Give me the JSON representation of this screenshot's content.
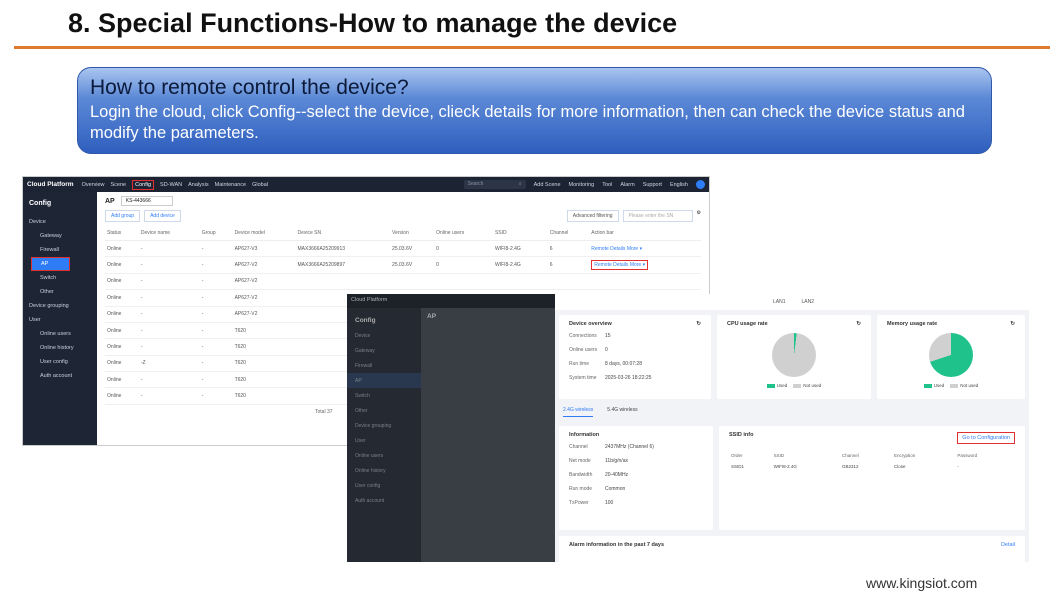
{
  "slide": {
    "title": "8. Special Functions-How to manage the device",
    "banner_title": "How to remote control the device?",
    "banner_text": "Login the cloud, click Config--select the device, clieck details for more information, then can check the device status and modify the parameters.",
    "footer": "www.kingsiot.com",
    "colors": {
      "rule": "#e07a2e",
      "banner": "#2f5fbf",
      "highlight": "#e03030"
    }
  },
  "ss1": {
    "brand": "Cloud Platform",
    "nav": [
      "Overview",
      "Scene",
      "Config",
      "SD-WAN",
      "Analysis",
      "Maintenance",
      "Global"
    ],
    "search_placeholder": "Search",
    "right_items": [
      "Add Scene",
      "Monitoring",
      "Tool",
      "Alarm",
      "Support",
      "English"
    ],
    "sidebar": {
      "header": "Config",
      "device": "Device",
      "device_subs": [
        "Gateway",
        "Firewall",
        "AP",
        "Switch",
        "Other"
      ],
      "device_grouping": "Device grouping",
      "user": "User",
      "user_subs": [
        "Online users",
        "Online history",
        "User config",
        "Auth account"
      ]
    },
    "ap_label": "AP",
    "select_value": "KS-443666",
    "buttons": {
      "add_group": "Add group",
      "add_device": "Add device",
      "advanced_filtering": "Advanced filtering",
      "sn_placeholder": "Please enter the SN"
    },
    "columns": [
      "Status",
      "Device name",
      "Group",
      "Device model",
      "Device SN",
      "Version",
      "Online users",
      "SSID",
      "Channel",
      "Action bar"
    ],
    "rows": [
      [
        "Online",
        "-",
        "-",
        "AP627-V3",
        "MAX3666A25209913",
        "25.03.6V",
        "0",
        "WIFI8-2.4G",
        "6",
        "Remote  Details  More ▾"
      ],
      [
        "Online",
        "-",
        "-",
        "AP627-V2",
        "MAX3666A25209897",
        "25.03.6V",
        "0",
        "WIFI8-2.4G",
        "6",
        "Remote  Details  More ▾"
      ],
      [
        "Online",
        "-",
        "-",
        "AP627-V2",
        "",
        "",
        "",
        "",
        "",
        ""
      ],
      [
        "Online",
        "-",
        "-",
        "AP627-V2",
        "",
        "",
        "",
        "",
        "",
        ""
      ],
      [
        "Online",
        "-",
        "-",
        "AP627-V2",
        "",
        "",
        "",
        "",
        "",
        ""
      ],
      [
        "Online",
        "-",
        "-",
        "T620",
        "",
        "",
        "",
        "",
        "",
        ""
      ],
      [
        "Online",
        "-",
        "-",
        "T620",
        "",
        "",
        "",
        "",
        "",
        ""
      ],
      [
        "Online",
        "-Z",
        "-",
        "T620",
        "",
        "",
        "",
        "",
        "",
        ""
      ],
      [
        "Online",
        "-",
        "-",
        "T620",
        "",
        "",
        "",
        "",
        "",
        ""
      ],
      [
        "Online",
        "-",
        "-",
        "T620",
        "",
        "",
        "",
        "",
        "",
        ""
      ]
    ],
    "total": "Total 37"
  },
  "ss2": {
    "brand": "Cloud Platform",
    "sidebar": [
      "Config",
      "Device",
      "Gateway",
      "Firewall",
      "AP",
      "Switch",
      "Other",
      "Device grouping",
      "User",
      "Online users",
      "Online history",
      "User config",
      "Auth account"
    ],
    "ap": "AP"
  },
  "ss3": {
    "top_links": [
      "LAN1",
      "LAN2"
    ],
    "overview": {
      "title": "Device overview",
      "items": [
        {
          "k": "Connections",
          "v": "15"
        },
        {
          "k": "Online users",
          "v": "0"
        },
        {
          "k": "Run time",
          "v": "8 days, 00:07:28"
        },
        {
          "k": "System time",
          "v": "2025-03-26 18:22:25"
        }
      ]
    },
    "cpu": {
      "title": "CPU usage rate",
      "used_pct": 2,
      "legend_used": "Used",
      "legend_not": "Not used"
    },
    "mem": {
      "title": "Memory usage rate",
      "used_pct": 70,
      "legend_used": "Used",
      "legend_not": "Not used"
    },
    "tabs": [
      "2.4G wireless",
      "5.4G wireless"
    ],
    "info": {
      "title": "Information",
      "items": [
        {
          "k": "Channel",
          "v": "2437MHz (Channel 6)"
        },
        {
          "k": "Net mode",
          "v": "11b/g/n/ax"
        },
        {
          "k": "Bandwidth",
          "v": "20-40MHz"
        },
        {
          "k": "Run mode",
          "v": "Common"
        },
        {
          "k": "TxPower",
          "v": "100"
        }
      ]
    },
    "ssid": {
      "title": "SSID info",
      "goto": "Go to Configuration",
      "columns": [
        "Order",
        "SSID",
        "Channel",
        "Encryption",
        "Password"
      ],
      "row": [
        "SSID1",
        "WIFI8-2.4G",
        "GB2312",
        "Close",
        "-"
      ]
    },
    "alarm": {
      "title": "Alarm information in the past 7 days",
      "detail": "Detail"
    },
    "colors": {
      "used": "#1fc28b",
      "not_used": "#d0d0d0"
    }
  }
}
